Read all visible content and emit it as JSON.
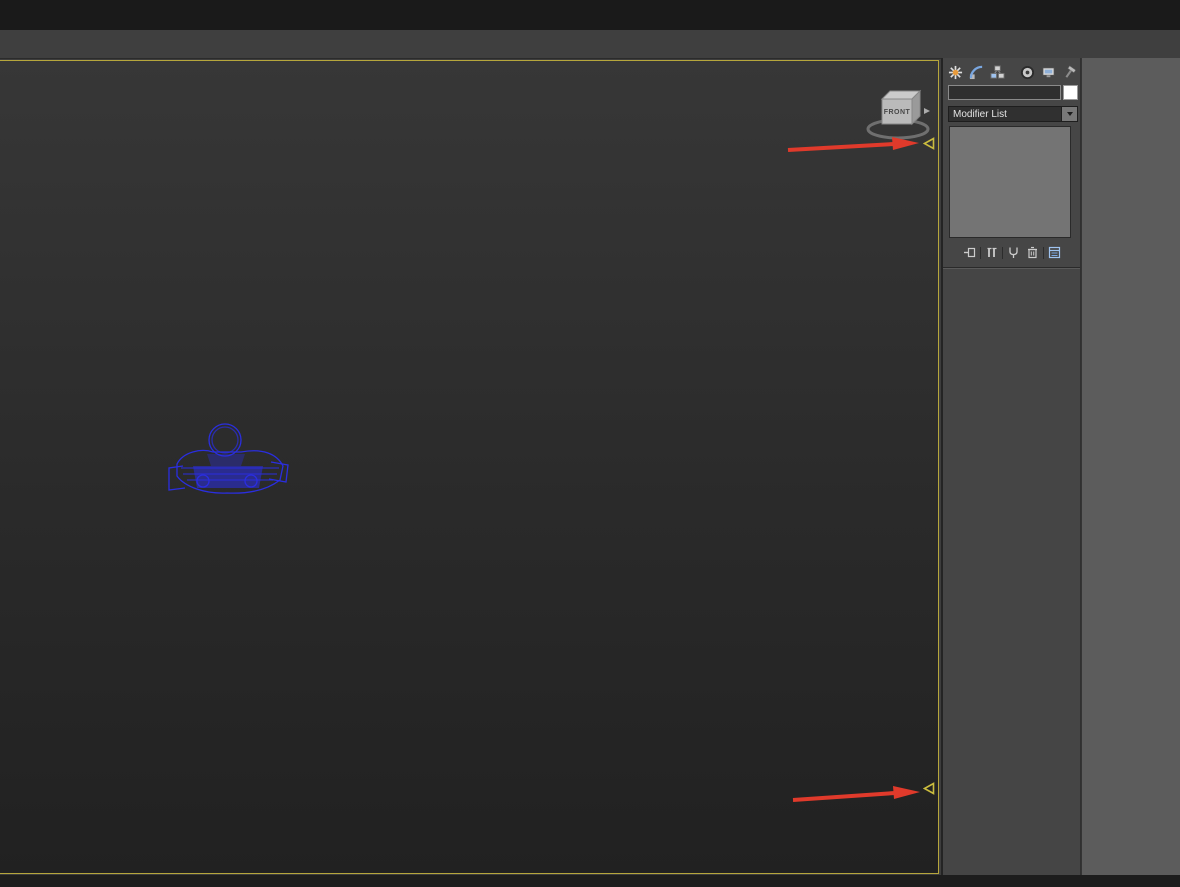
{
  "colors": {
    "viewport-border": "#b6a63c",
    "arrow": "#e03a2b",
    "wireframe": "#2a2ee0",
    "clip-marker": "#cabc3e"
  },
  "viewport": {
    "viewcube_label": "FRONT",
    "clip_markers": [
      "near-clip-slider",
      "far-clip-slider"
    ]
  },
  "command_panel": {
    "tabs": [
      {
        "name": "create"
      },
      {
        "name": "modify"
      },
      {
        "name": "hierarchy"
      },
      {
        "name": "motion"
      },
      {
        "name": "display"
      },
      {
        "name": "utilities"
      }
    ],
    "object_name_field": {
      "value": "",
      "swatch_color": "#ffffff"
    },
    "modifier_list": {
      "selected": "Modifier List"
    },
    "modifier_stack": {
      "items": []
    },
    "stack_buttons": [
      {
        "name": "pin-stack"
      },
      {
        "name": "show-end-result"
      },
      {
        "name": "make-unique"
      },
      {
        "name": "remove-modifier"
      },
      {
        "name": "configure-modifier-sets"
      }
    ]
  }
}
